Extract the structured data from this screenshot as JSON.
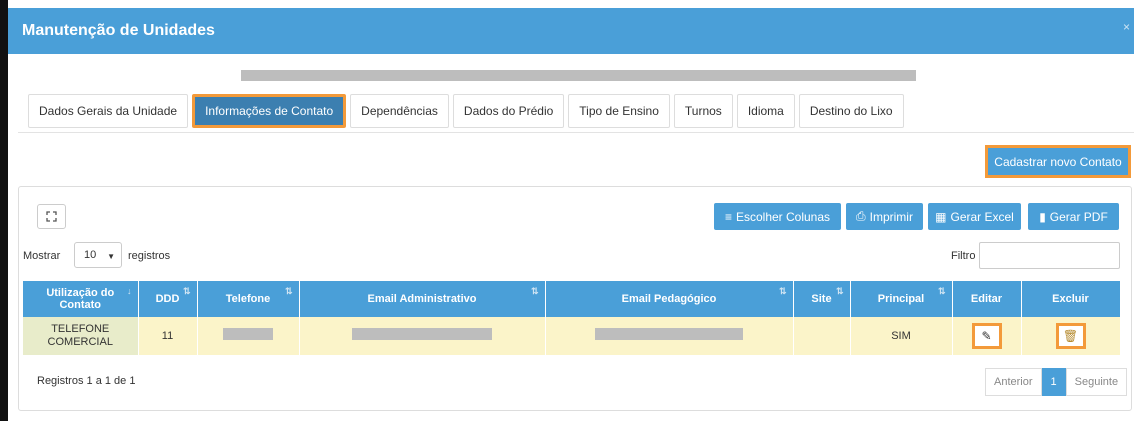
{
  "window": {
    "title": "Manutenção de Unidades",
    "close": "×"
  },
  "tabs": [
    {
      "label": "Dados Gerais da Unidade",
      "active": false
    },
    {
      "label": "Informações de Contato",
      "active": true
    },
    {
      "label": "Dependências",
      "active": false
    },
    {
      "label": "Dados do Prédio",
      "active": false
    },
    {
      "label": "Tipo de Ensino",
      "active": false
    },
    {
      "label": "Turnos",
      "active": false
    },
    {
      "label": "Idioma",
      "active": false
    },
    {
      "label": "Destino do Lixo",
      "active": false
    }
  ],
  "actions": {
    "new_contact": "Cadastrar novo Contato"
  },
  "toolbar": {
    "choose_columns": "Escolher Colunas",
    "print": "Imprimir",
    "excel": "Gerar Excel",
    "pdf": "Gerar PDF"
  },
  "length": {
    "prefix": "Mostrar",
    "value": "10",
    "suffix": "registros"
  },
  "filter": {
    "label": "Filtro",
    "value": ""
  },
  "table": {
    "headers": [
      "Utilização do Contato",
      "DDD",
      "Telefone",
      "Email Administrativo",
      "Email Pedagógico",
      "Site",
      "Principal",
      "Editar",
      "Excluir"
    ],
    "rows": [
      {
        "usage": "TELEFONE COMERCIAL",
        "ddd": "11",
        "telefone": "",
        "email_admin": "",
        "email_ped": "",
        "site": "",
        "principal": "SIM"
      }
    ]
  },
  "footer": {
    "info": "Registros 1 a 1 de 1",
    "prev": "Anterior",
    "page": "1",
    "next": "Seguinte"
  },
  "colors": {
    "primary": "#4a9fd8",
    "highlight": "#f39a3a",
    "row": "#fbf4c9"
  }
}
